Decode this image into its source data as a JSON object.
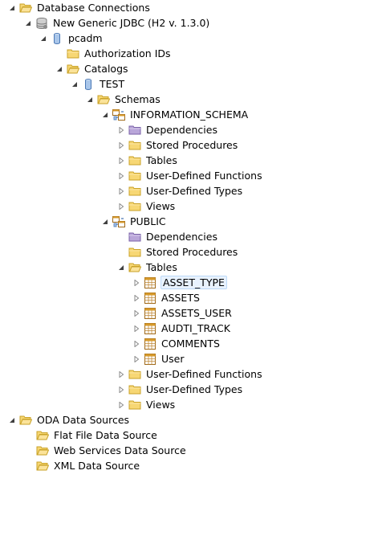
{
  "tree": {
    "database_connections": {
      "label": "Database Connections",
      "expanded": true,
      "icon": "folder-open-icon"
    },
    "h2_connection": {
      "label": "New Generic JDBC (H2 v. 1.3.0)",
      "icon": "db-connection-icon"
    },
    "pcadm": {
      "label": "pcadm",
      "icon": "database-icon"
    },
    "authorization_ids": {
      "label": "Authorization IDs",
      "icon": "folder-icon"
    },
    "catalogs": {
      "label": "Catalogs",
      "icon": "folder-open-icon"
    },
    "test": {
      "label": "TEST",
      "icon": "database-icon"
    },
    "schemas": {
      "label": "Schemas",
      "icon": "folder-open-icon"
    },
    "information_schema": {
      "label": "INFORMATION_SCHEMA",
      "icon": "schema-icon",
      "children": [
        {
          "label": "Dependencies",
          "icon": "dependencies-folder-icon"
        },
        {
          "label": "Stored Procedures",
          "icon": "folder-icon"
        },
        {
          "label": "Tables",
          "icon": "folder-icon"
        },
        {
          "label": "User-Defined Functions",
          "icon": "folder-icon"
        },
        {
          "label": "User-Defined Types",
          "icon": "folder-icon"
        },
        {
          "label": "Views",
          "icon": "folder-icon"
        }
      ]
    },
    "public": {
      "label": "PUBLIC",
      "icon": "schema-icon",
      "dependencies": {
        "label": "Dependencies",
        "icon": "dependencies-folder-icon"
      },
      "stored_procedures": {
        "label": "Stored Procedures",
        "icon": "folder-icon"
      },
      "tables": {
        "label": "Tables",
        "icon": "folder-open-icon",
        "items": [
          {
            "label": "ASSET_TYPE",
            "icon": "table-icon",
            "selected": true
          },
          {
            "label": "ASSETS",
            "icon": "table-icon"
          },
          {
            "label": "ASSETS_USER",
            "icon": "table-icon"
          },
          {
            "label": "AUDTI_TRACK",
            "icon": "table-icon"
          },
          {
            "label": "COMMENTS",
            "icon": "table-icon"
          },
          {
            "label": "User",
            "icon": "table-icon"
          }
        ]
      },
      "user_defined_functions": {
        "label": "User-Defined Functions",
        "icon": "folder-icon"
      },
      "user_defined_types": {
        "label": "User-Defined Types",
        "icon": "folder-icon"
      },
      "views": {
        "label": "Views",
        "icon": "folder-icon"
      }
    },
    "oda_data_sources": {
      "label": "ODA Data Sources",
      "icon": "folder-open-icon",
      "children": [
        {
          "label": "Flat File Data Source",
          "icon": "folder-open-icon"
        },
        {
          "label": "Web Services Data Source",
          "icon": "folder-open-icon"
        },
        {
          "label": "XML Data Source",
          "icon": "folder-open-icon"
        }
      ]
    }
  },
  "colors": {
    "folder_fill": "#f7d774",
    "folder_stroke": "#c9a227",
    "dependencies_fill": "#b9a6d9",
    "db_fill": "#a9c6ea",
    "table_header": "#d79a2b",
    "selection_bg": "#e8f2fe",
    "selection_border": "#bcd9f7"
  }
}
